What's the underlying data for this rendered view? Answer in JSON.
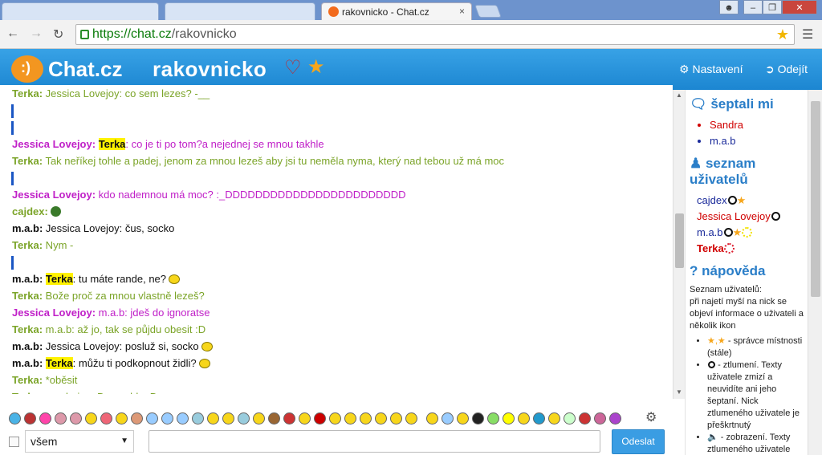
{
  "browser": {
    "tabs": [
      {
        "title": ""
      },
      {
        "title": ""
      },
      {
        "title": "rakovnicko - Chat.cz",
        "active": true
      }
    ],
    "url_host": "https://chat.cz",
    "url_path": "/rakovnicko",
    "close_glyph": "×"
  },
  "header": {
    "logo_text": "Chat.cz",
    "logo_glyph": ":)",
    "room_name": "rakovnicko",
    "settings_label": "Nastavení",
    "logout_label": "Odejít"
  },
  "messages": [
    {
      "type": "msg",
      "nick": "Terka:",
      "text": " Jessica Lovejoy: co sem lezes? -__",
      "color": "terka"
    },
    {
      "type": "bar"
    },
    {
      "type": "bar"
    },
    {
      "type": "msg",
      "nick": "Jessica Lovejoy:",
      "hl": "Terka",
      "text": ": co je ti po tom?a nejednej se mnou takhle",
      "color": "jess"
    },
    {
      "type": "msg",
      "nick": "Terka:",
      "text": " Tak neříkej tohle a padej, jenom za mnou lezeš aby jsi tu neměla nyma, který nad tebou už má moc",
      "color": "terka"
    },
    {
      "type": "bar"
    },
    {
      "type": "msg",
      "nick": "Jessica Lovejoy:",
      "text": " kdo nademnou má moc? :_DDDDDDDDDDDDDDDDDDDDDDDD",
      "color": "jess"
    },
    {
      "type": "msg",
      "nick": "cajdex:",
      "text": "",
      "color": "cajd",
      "icon": "frog"
    },
    {
      "type": "msg",
      "nick": "m.a.b:",
      "text": " Jessica Lovejoy: čus, socko",
      "color": "mab"
    },
    {
      "type": "msg",
      "nick": "Terka:",
      "text": " Nym -",
      "color": "terka"
    },
    {
      "type": "bar"
    },
    {
      "type": "msg",
      "nick": "m.a.b:",
      "hl": "Terka",
      "text": ": tu máte rande, ne?",
      "color": "mab",
      "icon": "smiley"
    },
    {
      "type": "msg",
      "nick": "Terka:",
      "text": " Bože proč za mnou vlastně lezeš?",
      "color": "terka"
    },
    {
      "type": "msg",
      "nick": "Jessica Lovejoy:",
      "text": " m.a.b: jdeš do ignoratse",
      "color": "jess"
    },
    {
      "type": "msg",
      "nick": "Terka:",
      "text": " m.a.b: až jo, tak se půjdu obesit :D",
      "color": "terka"
    },
    {
      "type": "msg",
      "nick": "m.a.b:",
      "text": " Jessica Lovejoy: posluž si, socko",
      "color": "mab",
      "icon": "smiley"
    },
    {
      "type": "msg",
      "nick": "m.a.b:",
      "hl": "Terka",
      "text": ": můžu ti podkopnout židli?",
      "color": "mab",
      "icon": "smiley"
    },
    {
      "type": "msg",
      "nick": "Terka:",
      "text": " *oběsit",
      "color": "terka"
    },
    {
      "type": "msg",
      "nick": "Terka:",
      "text": " m.a.b: jop :D a rychle :D",
      "color": "terka"
    }
  ],
  "side": {
    "whisper_title": "šeptali mi",
    "whisper_users": [
      {
        "name": "Sandra",
        "color": "#d00000"
      },
      {
        "name": "m.a.b",
        "color": "#1a2a9a"
      }
    ],
    "userlist_title_1": "seznam",
    "userlist_title_2": "uživatelů",
    "users": [
      {
        "name": "cajdex",
        "color": "#1a2a9a",
        "badges": [
          "ban",
          "star"
        ]
      },
      {
        "name": "Jessica Lovejoy",
        "color": "#d00000",
        "badges": [
          "ban"
        ]
      },
      {
        "name": "m.a.b",
        "color": "#1a2a9a",
        "badges": [
          "ban",
          "star",
          "sun"
        ]
      },
      {
        "name": "Terka",
        "color": "#d00000",
        "bold": true,
        "badges": [
          "sunred"
        ]
      }
    ],
    "help_title": "nápověda",
    "help_intro_1": "Seznam uživatelů:",
    "help_intro_2": "při najetí myší na nick se objeví informace o uživateli a několik ikon",
    "help_items": [
      "- správce místnosti (stále)",
      "- ztlumení. Texty uživatele zmizí a neuvidíte ani jeho šeptaní. Nick ztlumeného uživatele je přeškrtnutý",
      "- zobrazení. Texty ztlumeného uživatele jsou"
    ]
  },
  "input": {
    "target_value": "všem",
    "send_label": "Odeslat",
    "message_value": ""
  },
  "colors": {
    "header_blue": "#2a94dc",
    "terka": "#7ba428",
    "jessica": "#c020c8",
    "highlight": "#fff200",
    "send_button": "#3a9de3"
  }
}
